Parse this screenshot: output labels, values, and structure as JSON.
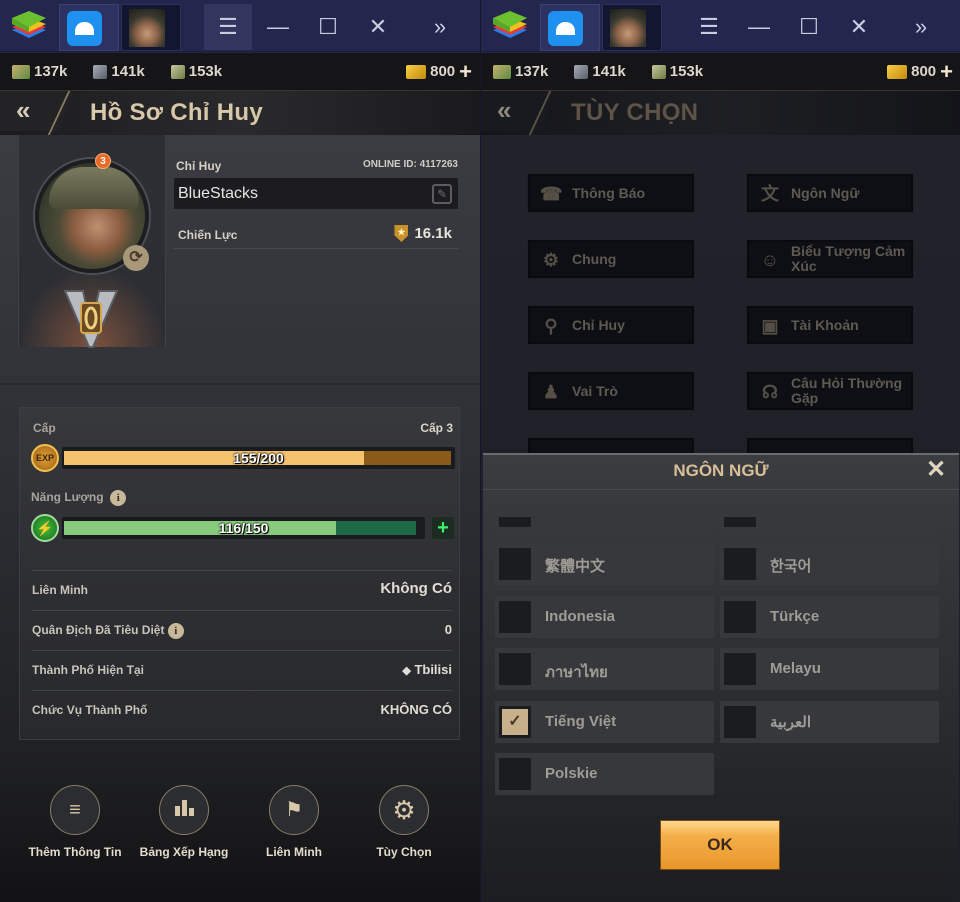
{
  "emulator": {
    "logo_icon": "bluestacks-logo-icon",
    "tabs": [
      {
        "name": "Home",
        "icon": "home-icon"
      },
      {
        "name": "Game",
        "icon": "game-thumbnail-icon"
      }
    ],
    "controls": {
      "menu": "☰",
      "minimize": "—",
      "maximize": "☐",
      "close": "✕",
      "expand": "»"
    }
  },
  "resources": {
    "cash": "137k",
    "iron": "141k",
    "oil": "153k",
    "gold": "800",
    "add": "+"
  },
  "left": {
    "back": "«",
    "title": "Hồ Sơ Chỉ Huy",
    "commander_label": "Chỉ Huy",
    "online_id": "ONLINE ID: 4117263",
    "name_value": "BlueStacks",
    "power_label": "Chiến Lực",
    "power_value": "16.1k",
    "rank_badge": "3",
    "level_label": "Cấp",
    "level_value": "Cấp 3",
    "exp": {
      "icon": "EXP",
      "text": "155/200",
      "current": 155,
      "max": 200,
      "color": "#f5c36e",
      "track": "#8a5a18"
    },
    "energy": {
      "label": "Năng Lượng",
      "text": "116/150",
      "current": 116,
      "max": 150,
      "color": "#86cc7c",
      "track": "#1e6a44",
      "add": "+"
    },
    "rows": [
      {
        "label": "Liên Minh",
        "value": "Không Có",
        "info": false
      },
      {
        "label": "Quân Địch Đã Tiêu Diệt",
        "value": "0",
        "info": true
      },
      {
        "label": "Thành Phố Hiện Tại",
        "value": "Tbilisi",
        "info": false
      },
      {
        "label": "Chức Vụ Thành Phố",
        "value": "KHÔNG CÓ",
        "info": false
      }
    ],
    "nav": [
      {
        "label": "Thêm Thông Tin",
        "icon": "≡"
      },
      {
        "label": "Bảng Xếp Hạng",
        "icon": "▮"
      },
      {
        "label": "Liên Minh",
        "icon": "⚑"
      },
      {
        "label": "Tùy Chọn",
        "icon": "⚙"
      }
    ]
  },
  "right": {
    "back": "«",
    "title": "TÙY CHỌN",
    "options": [
      {
        "label": "Thông Báo",
        "icon": "☎"
      },
      {
        "label": "Ngôn Ngữ",
        "icon": "文"
      },
      {
        "label": "Chung",
        "icon": "⚙"
      },
      {
        "label": "Biểu Tượng Cảm Xúc",
        "icon": "☺"
      },
      {
        "label": "Chỉ Huy",
        "icon": "⚲"
      },
      {
        "label": "Tài Khoản",
        "icon": "▣"
      },
      {
        "label": "Vai Trò",
        "icon": "♟"
      },
      {
        "label": "Câu Hỏi Thường Gặp",
        "icon": "☊"
      }
    ],
    "modal": {
      "title": "NGÔN NGỮ",
      "close": "✕",
      "languages": [
        {
          "label": "繁體中文",
          "checked": false
        },
        {
          "label": "한국어",
          "checked": false
        },
        {
          "label": "Indonesia",
          "checked": false
        },
        {
          "label": "Türkçe",
          "checked": false
        },
        {
          "label": "ภาษาไทย",
          "checked": false
        },
        {
          "label": "Melayu",
          "checked": false
        },
        {
          "label": "Tiếng Việt",
          "checked": true
        },
        {
          "label": "العربية",
          "checked": false
        },
        {
          "label": "Polskie",
          "checked": false
        }
      ],
      "ok": "OK",
      "check": "✓"
    }
  }
}
